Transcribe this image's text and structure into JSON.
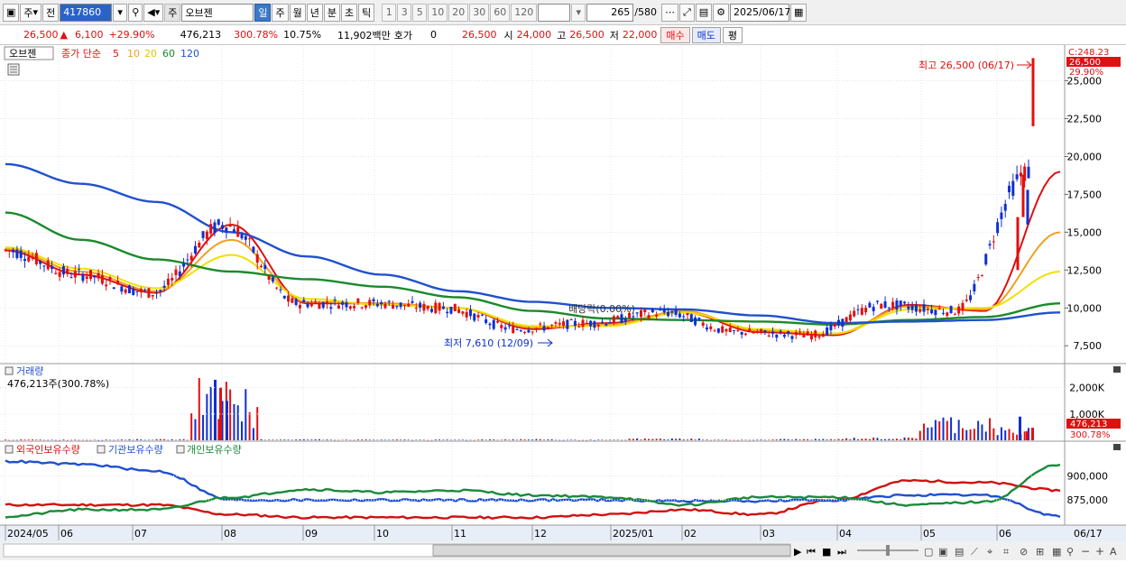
{
  "toolbar": {
    "ju": "주",
    "jeon": "전",
    "code": "417860",
    "market_tag": "주",
    "stock_name": "오브젠",
    "periods": [
      "일",
      "주",
      "월",
      "년",
      "분",
      "초",
      "틱"
    ],
    "selected_period": "일",
    "intervals": [
      "1",
      "3",
      "5",
      "10",
      "20",
      "30",
      "60",
      "120"
    ],
    "count_value": "265",
    "count_total": "/580",
    "date": "2025/06/17"
  },
  "quote": {
    "price": "26,500",
    "change": "6,100",
    "change_pct": "+29.90%",
    "volume": "476,213",
    "volume_ratio": "300.78%",
    "turnover": "10.75%",
    "amount": "11,902백만",
    "hoga_label": "호가",
    "hoga_value": "0",
    "hoga_price": "26,500",
    "open_label": "시",
    "open_value": "24,000",
    "high_label": "고",
    "high_value": "26,500",
    "low_label": "저",
    "low_value": "22,000",
    "buy_label": "매수",
    "sell_label": "매도",
    "eval_label": "평"
  },
  "price_panel": {
    "stock_label": "오브젠",
    "ma_label": "종가 단순",
    "ma_periods": [
      {
        "label": "5",
        "color": "#e01010"
      },
      {
        "label": "10",
        "color": "#f0a020"
      },
      {
        "label": "20",
        "color": "#f0e000"
      },
      {
        "label": "60",
        "color": "#1a8a2a"
      },
      {
        "label": "120",
        "color": "#2050d0"
      }
    ],
    "y_ticks": [
      "25,000",
      "22,500",
      "20,000",
      "17,500",
      "15,000",
      "12,500",
      "10,000",
      "7,500"
    ],
    "current_price_tag": "26,500",
    "current_pct_tag": "29.90%",
    "top_tag": "C:248.23",
    "high_annotation": "최고 26,500 (06/17)",
    "low_annotation": "최저 7,610 (12/09)",
    "dividend_annotation": "배당락(0.00%)"
  },
  "volume_panel": {
    "title": "거래량",
    "value_label": "476,213주(300.78%)",
    "y_ticks": [
      "2,000K",
      "1,000K"
    ],
    "current_tag": "476,213",
    "current_pct_tag": "300.78%"
  },
  "holding_panel": {
    "legend": [
      {
        "label": "외국인보유수량",
        "color": "#d01010"
      },
      {
        "label": "기관보유수량",
        "color": "#2050d0"
      },
      {
        "label": "개인보유수량",
        "color": "#1a8a3a"
      }
    ],
    "y_ticks": [
      "900,000",
      "875,000"
    ]
  },
  "x_axis": [
    "2024/05",
    "06",
    "07",
    "08",
    "09",
    "10",
    "11",
    "12",
    "2025/01",
    "02",
    "03",
    "04",
    "05",
    "06",
    "06/17"
  ],
  "colors": {
    "up": "#e01010",
    "down": "#1030d0",
    "highlight": "#2b62c8"
  },
  "chart_data": [
    {
      "type": "line",
      "title": "",
      "series": [
        {
          "name": "5",
          "x": [
            "2024/05",
            "06",
            "07",
            "08",
            "09",
            "10",
            "11",
            "12",
            "2025/01",
            "02",
            "03",
            "04",
            "05",
            "06",
            "06/17"
          ],
          "y": [
            13800,
            12200,
            11000,
            15500,
            10300,
            10300,
            10000,
            8600,
            9000,
            9700,
            8400,
            8200,
            10200,
            9800,
            19000
          ]
        },
        {
          "name": "10",
          "x": [
            "2024/05",
            "06",
            "07",
            "08",
            "09",
            "10",
            "11",
            "12",
            "2025/01",
            "02",
            "03",
            "04",
            "05",
            "06",
            "06/17"
          ],
          "y": [
            13900,
            12400,
            11100,
            14500,
            10400,
            10300,
            10000,
            8700,
            8900,
            9800,
            8500,
            8300,
            10100,
            9900,
            15000
          ]
        },
        {
          "name": "20",
          "x": [
            "2024/05",
            "06",
            "07",
            "08",
            "09",
            "10",
            "11",
            "12",
            "2025/01",
            "02",
            "03",
            "04",
            "05",
            "06",
            "06/17"
          ],
          "y": [
            14000,
            12600,
            11300,
            13500,
            10600,
            10200,
            10000,
            8800,
            8800,
            9700,
            8600,
            8300,
            9900,
            10000,
            12400
          ]
        },
        {
          "name": "60",
          "x": [
            "2024/05",
            "06",
            "07",
            "08",
            "09",
            "10",
            "11",
            "12",
            "2025/01",
            "02",
            "03",
            "04",
            "05",
            "06",
            "06/17"
          ],
          "y": [
            16300,
            14500,
            13200,
            12400,
            11900,
            11400,
            10700,
            9800,
            9300,
            9200,
            9100,
            8900,
            9200,
            9400,
            10300
          ]
        },
        {
          "name": "120",
          "x": [
            "2024/05",
            "06",
            "07",
            "08",
            "09",
            "10",
            "11",
            "12",
            "2025/01",
            "02",
            "03",
            "04",
            "05",
            "06",
            "06/17"
          ],
          "y": [
            19500,
            18200,
            17000,
            15000,
            13400,
            12200,
            11100,
            10400,
            10000,
            9900,
            9500,
            9000,
            9100,
            9200,
            9700
          ]
        }
      ],
      "xlabel": "",
      "ylabel": "",
      "ylim": [
        6500,
        27000
      ],
      "high": 26500,
      "low": 7610
    },
    {
      "type": "bar",
      "title": "",
      "categories": [
        "2024/05",
        "06",
        "07",
        "08",
        "09",
        "10",
        "11",
        "12",
        "2025/01",
        "02",
        "03",
        "04",
        "05",
        "06",
        "06/17"
      ],
      "values": [
        30,
        25,
        40,
        2300,
        40,
        30,
        25,
        45,
        20,
        70,
        25,
        50,
        100,
        900,
        476
      ],
      "ylim": [
        0,
        2400
      ]
    },
    {
      "type": "line",
      "title": "",
      "series": [
        {
          "name": "외국인보유수량",
          "x": [
            "2024/05",
            "06",
            "07",
            "08",
            "09",
            "10",
            "11",
            "12",
            "2025/01",
            "02",
            "03",
            "04",
            "05",
            "06",
            "06/17"
          ],
          "y": [
            870000,
            870000,
            870000,
            860000,
            857000,
            857000,
            857000,
            857000,
            860000,
            865000,
            860000,
            875000,
            895000,
            893000,
            885000
          ]
        },
        {
          "name": "기관보유수량",
          "x": [
            "2024/05",
            "06",
            "07",
            "08",
            "09",
            "10",
            "11",
            "12",
            "2025/01",
            "02",
            "03",
            "04",
            "05",
            "06",
            "06/17"
          ],
          "y": [
            915000,
            912000,
            905000,
            875000,
            875000,
            875000,
            875000,
            875000,
            875000,
            874000,
            874000,
            875000,
            880000,
            880000,
            858000
          ]
        },
        {
          "name": "개인보유수량",
          "x": [
            "2024/05",
            "06",
            "07",
            "08",
            "09",
            "10",
            "11",
            "12",
            "2025/01",
            "02",
            "03",
            "04",
            "05",
            "06",
            "06/17"
          ],
          "y": [
            858000,
            865000,
            865000,
            878000,
            886000,
            883000,
            885000,
            880000,
            878000,
            870000,
            878000,
            878000,
            870000,
            873000,
            912000
          ]
        }
      ],
      "ylim": [
        850000,
        920000
      ]
    }
  ]
}
